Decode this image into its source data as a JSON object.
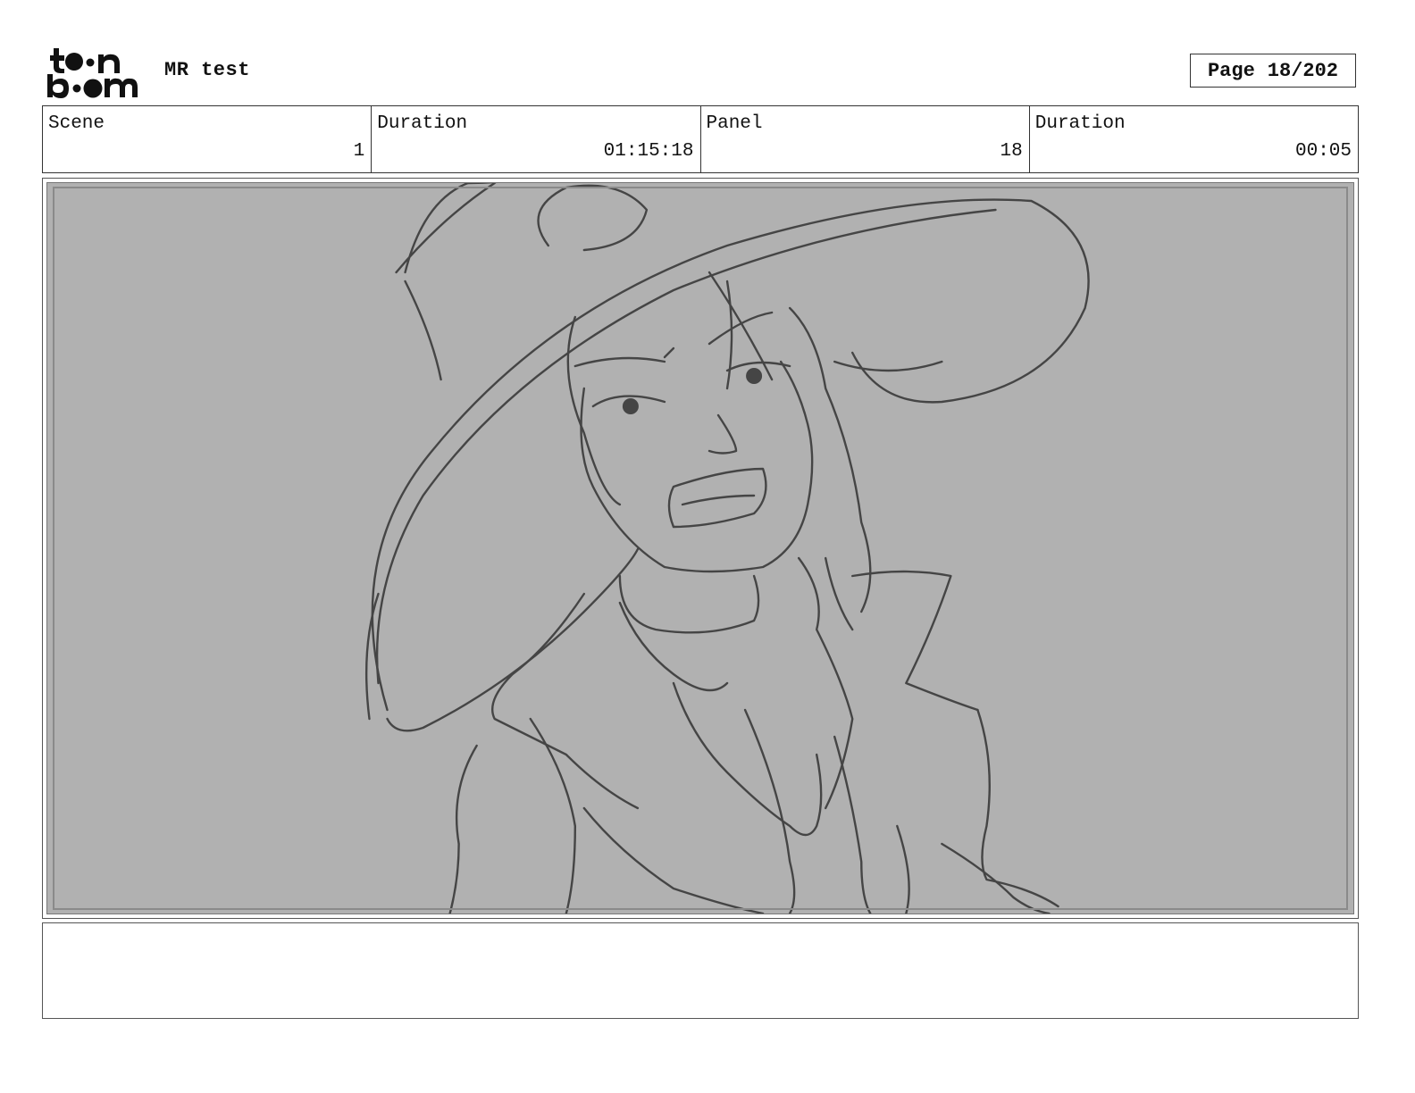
{
  "header": {
    "logo_text_top": "toon",
    "logo_text_bottom": "boom",
    "project_title": "MR test",
    "page_label": "Page",
    "page_number": "18/202"
  },
  "info": [
    {
      "label": "Scene",
      "value": "1"
    },
    {
      "label": "Duration",
      "value": "01:15:18"
    },
    {
      "label": "Panel",
      "value": "18"
    },
    {
      "label": "Duration",
      "value": "00:05"
    }
  ],
  "panel": {
    "description": "",
    "background_color": "#b1b1b1",
    "stroke_color": "#3a3a3a"
  },
  "notes": {
    "text": ""
  }
}
